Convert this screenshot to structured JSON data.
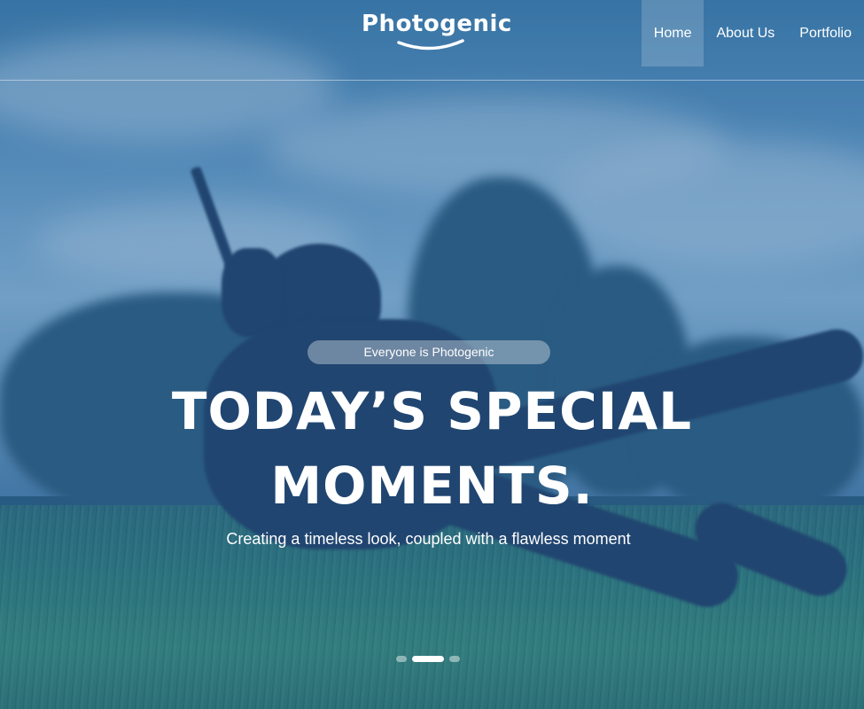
{
  "header": {
    "logo_text": "Photogenic",
    "nav": [
      {
        "label": "Home",
        "active": true
      },
      {
        "label": "About Us",
        "active": false
      },
      {
        "label": "Portfolio",
        "active": false
      }
    ]
  },
  "hero": {
    "tagline": "Everyone is Photogenic",
    "headline_line1": "TODAY’S SPECIAL",
    "headline_line2": "MOMENTS.",
    "subtitle": "Creating a timeless look, coupled with a flawless moment",
    "background_image": "photographer-jumping-over-grass-field",
    "overlay_color": "#2355a0"
  },
  "slider": {
    "slide_count": 3,
    "active_index": 1
  },
  "colors": {
    "text": "#ffffff",
    "pill_bg": "rgba(255,255,255,0.35)"
  }
}
